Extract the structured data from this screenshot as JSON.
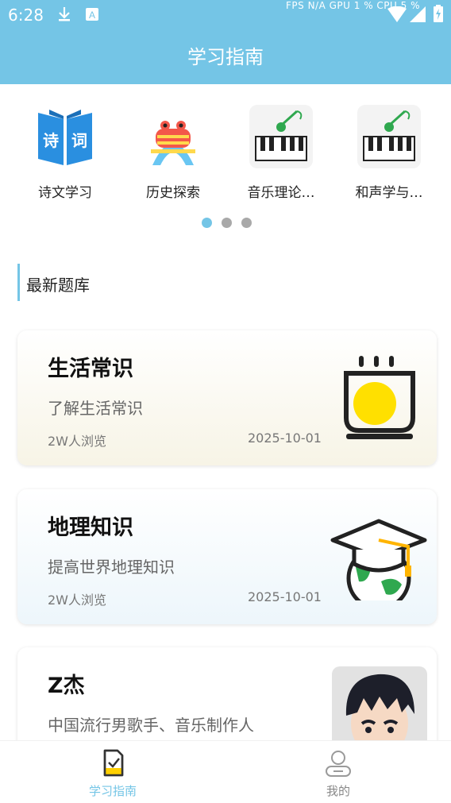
{
  "status_bar": {
    "time": "6:28",
    "perf_overlay": "FPS  N/A  GPU   1 %   CPU   5 %  "
  },
  "header": {
    "title": "学习指南"
  },
  "categories": [
    {
      "label": "诗文学习",
      "icon": "poetry-book-icon"
    },
    {
      "label": "历史探索",
      "icon": "history-monument-icon"
    },
    {
      "label": "音乐理论…",
      "icon": "piano-icon"
    },
    {
      "label": "和声学与…",
      "icon": "piano-icon"
    }
  ],
  "carousel": {
    "page_count": 3,
    "active_index": 0
  },
  "section": {
    "title": "最新题库"
  },
  "cards": [
    {
      "title": "生活常识",
      "desc": "了解生活常识",
      "views": "2W人浏览",
      "date": "2025-10-01",
      "icon": "cup-icon"
    },
    {
      "title": "地理知识",
      "desc": "提高世界地理知识",
      "views": "2W人浏览",
      "date": "2025-10-01",
      "icon": "graduation-globe-icon"
    },
    {
      "title": "Z杰",
      "desc": "中国流行男歌手、音乐制作人",
      "views": "",
      "date": "",
      "icon": "avatar-boy-icon"
    }
  ],
  "bottom_nav": [
    {
      "label": "学习指南",
      "active": true,
      "icon": "study-guide-icon"
    },
    {
      "label": "我的",
      "active": false,
      "icon": "user-profile-icon"
    }
  ],
  "colors": {
    "accent": "#74c5e6",
    "inactive": "#888888",
    "card1_bg": "#faf7ec",
    "card2_bg": "#eef7fc"
  }
}
